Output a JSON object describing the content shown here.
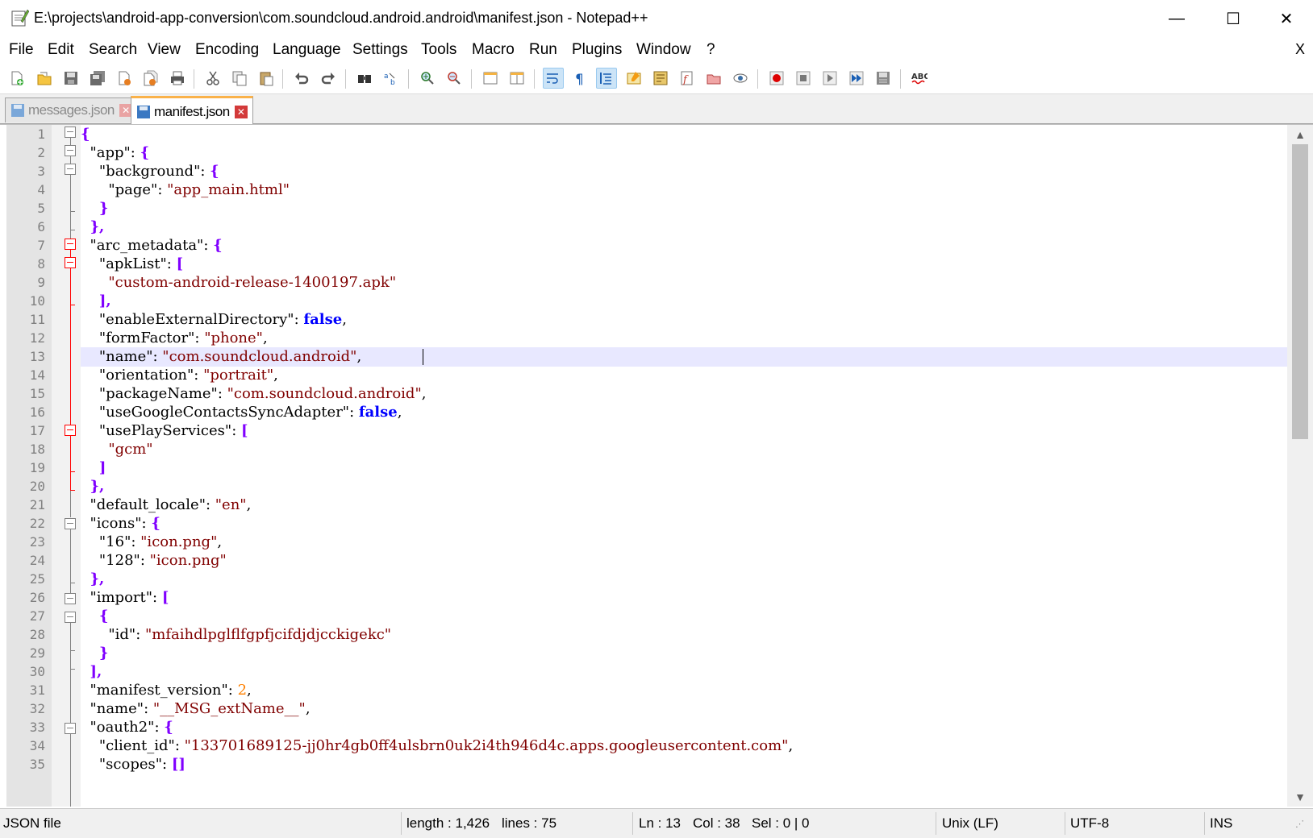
{
  "window": {
    "title": "E:\\projects\\android-app-conversion\\com.soundcloud.android.android\\manifest.json - Notepad++",
    "minimize": "—",
    "maximize": "☐",
    "close": "✕"
  },
  "menu": {
    "items": [
      "File",
      "Edit",
      "Search",
      "View",
      "Encoding",
      "Language",
      "Settings",
      "Tools",
      "Macro",
      "Run",
      "Plugins",
      "Window",
      "?"
    ],
    "close_doc": "X"
  },
  "toolbar": {
    "buttons": [
      "new-file",
      "open-file",
      "save",
      "save-all",
      "close",
      "close-all",
      "print",
      "cut",
      "copy",
      "paste",
      "undo",
      "redo",
      "find",
      "replace",
      "zoom-in",
      "zoom-out",
      "sync-vertical",
      "sync-horizontal",
      "word-wrap",
      "show-all-characters",
      "indent-guide",
      "user-defined-language",
      "document-map",
      "function-list",
      "folder-as-workspace",
      "monitoring",
      "start-recording",
      "stop-recording",
      "playback",
      "run-macro-multiple",
      "save-macro",
      "spell-check"
    ],
    "spell_label": "ABC"
  },
  "tabs": [
    {
      "label": "messages.json",
      "active": false
    },
    {
      "label": "manifest.json",
      "active": true
    }
  ],
  "editor": {
    "current_line": 13,
    "lines": [
      "1",
      "2",
      "3",
      "4",
      "5",
      "6",
      "7",
      "8",
      "9",
      "10",
      "11",
      "12",
      "13",
      "14",
      "15",
      "16",
      "17",
      "18",
      "19",
      "20",
      "21",
      "22",
      "23",
      "24",
      "25",
      "26",
      "27",
      "28",
      "29",
      "30",
      "31",
      "32",
      "33",
      "34",
      "35"
    ]
  },
  "statusbar": {
    "file_type": "JSON file",
    "length": "length : 1,426",
    "lines": "lines : 75",
    "ln": "Ln : 13",
    "col": "Col : 38",
    "sel": "Sel : 0 | 0",
    "eol": "Unix (LF)",
    "encoding": "UTF-8",
    "mode": "INS"
  }
}
